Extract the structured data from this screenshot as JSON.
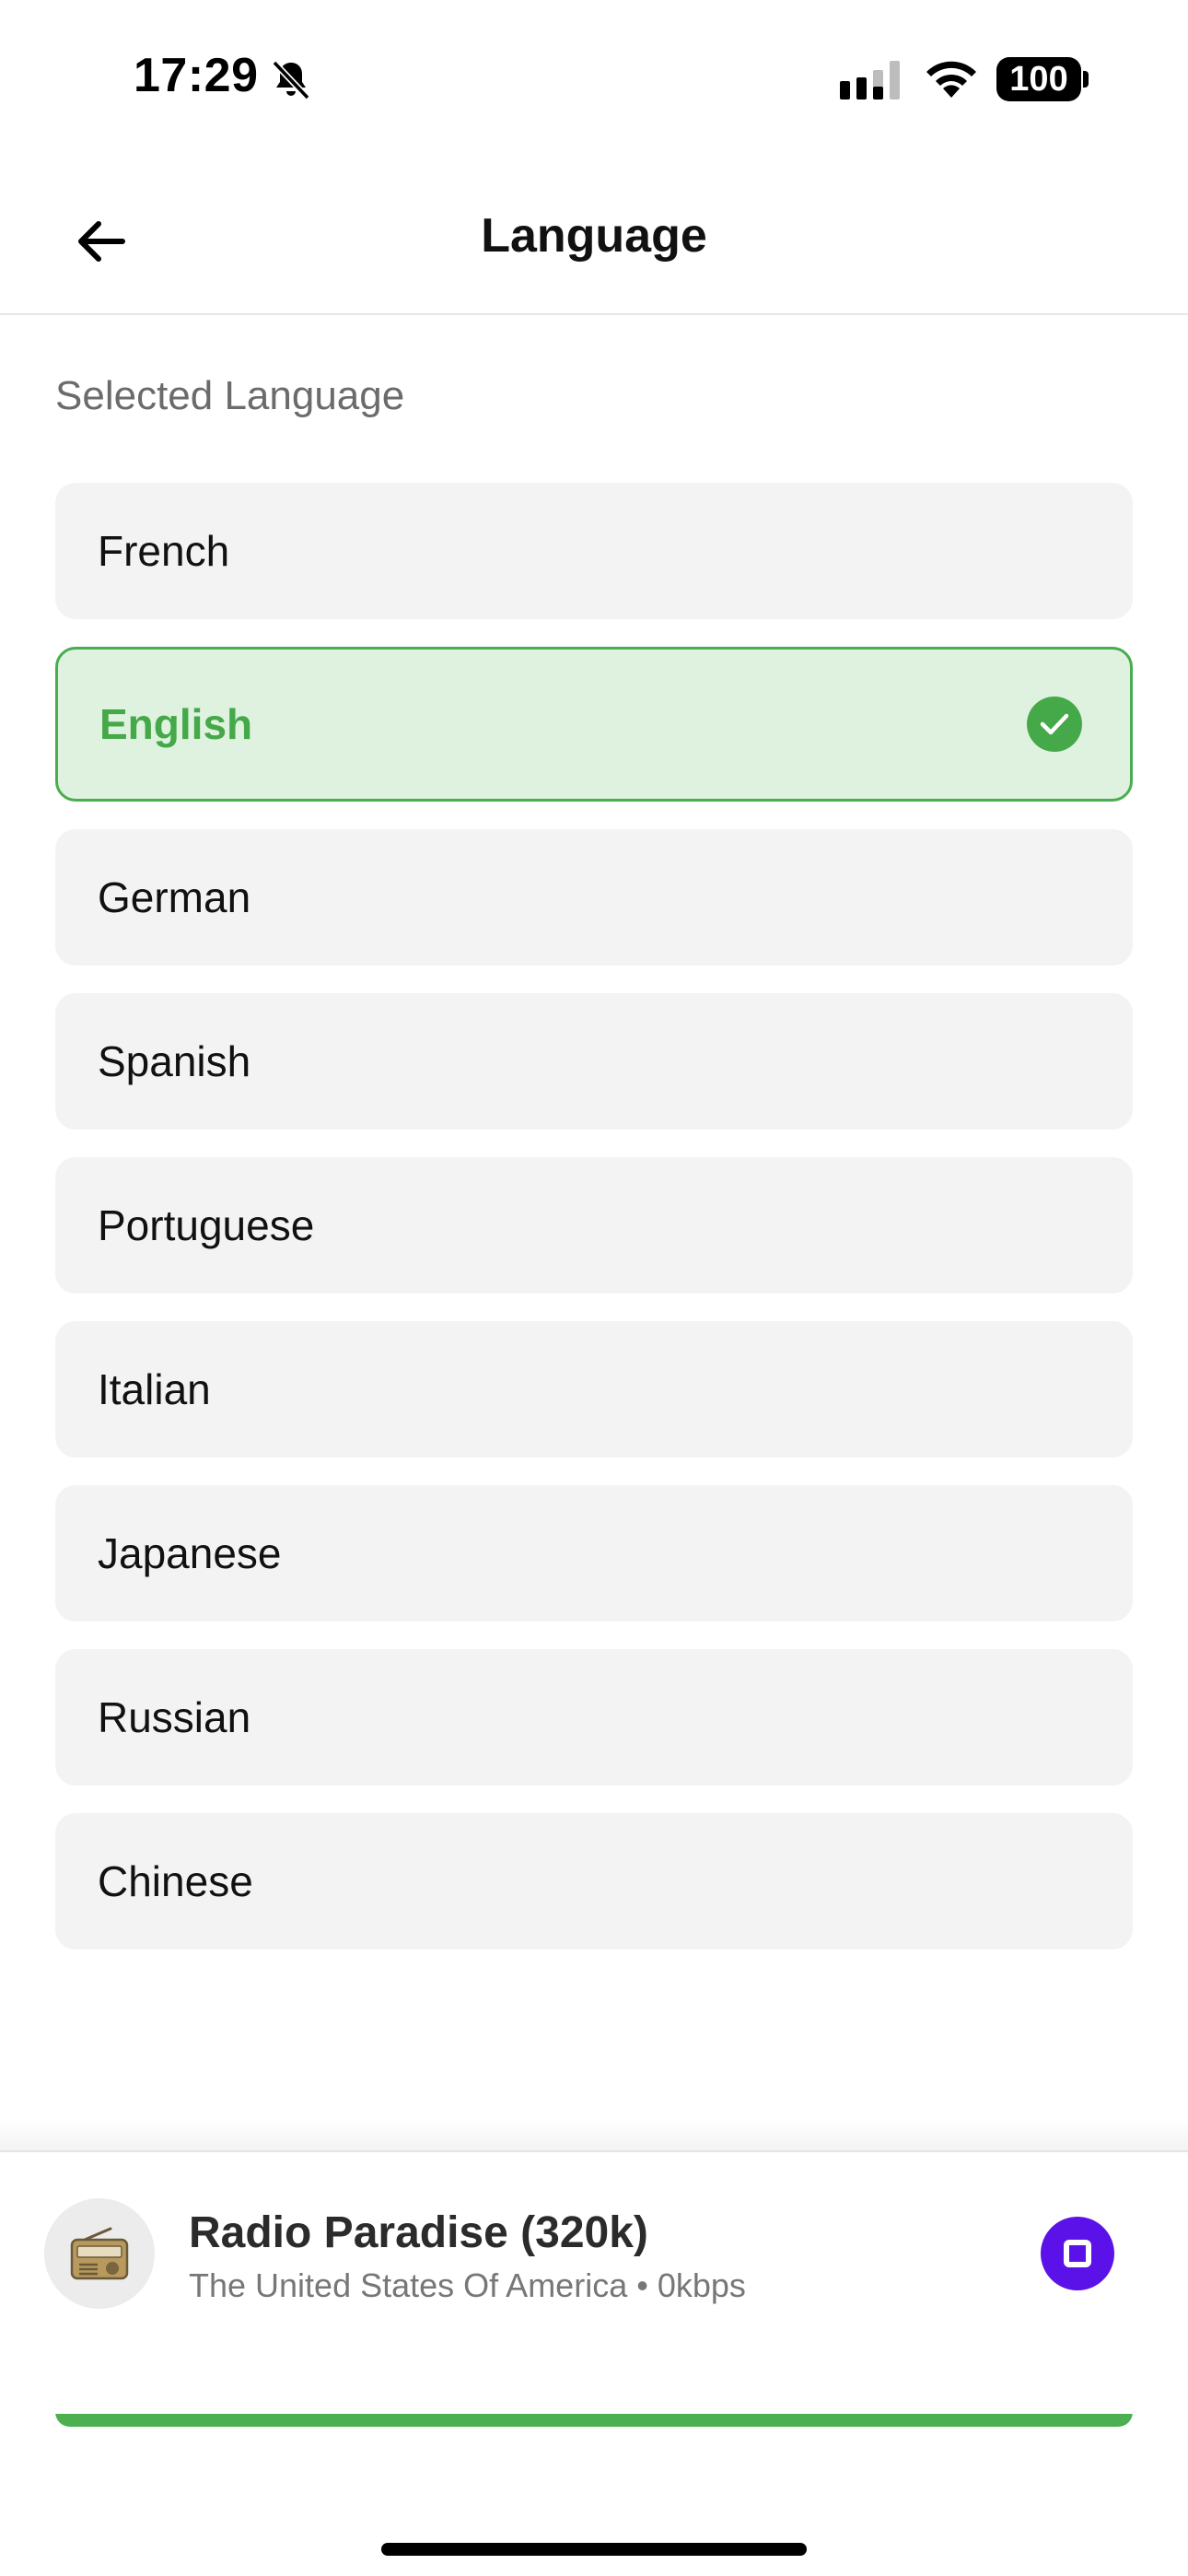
{
  "status_bar": {
    "time": "17:29",
    "battery": "100",
    "icons": [
      "bell-slash-icon",
      "signal-icon",
      "wifi-icon",
      "battery-icon"
    ]
  },
  "header": {
    "title": "Language",
    "back_icon": "arrow-left-icon"
  },
  "section": {
    "label": "Selected Language"
  },
  "languages": [
    {
      "label": "French",
      "selected": false
    },
    {
      "label": "English",
      "selected": true
    },
    {
      "label": "German",
      "selected": false
    },
    {
      "label": "Spanish",
      "selected": false
    },
    {
      "label": "Portuguese",
      "selected": false
    },
    {
      "label": "Italian",
      "selected": false
    },
    {
      "label": "Japanese",
      "selected": false
    },
    {
      "label": "Russian",
      "selected": false
    },
    {
      "label": "Chinese",
      "selected": false
    }
  ],
  "player": {
    "station_name": "Radio Paradise (320k)",
    "station_meta": "The United States Of America • 0kbps",
    "avatar_icon": "radio-icon",
    "control_icon": "stop-icon"
  },
  "colors": {
    "selected_bg": "#dff2df",
    "selected_border": "#48ad4e",
    "selected_text": "#45a849",
    "item_bg": "#f3f3f3",
    "stop_button": "#5a12e8",
    "bottom_button": "#4caf50"
  }
}
